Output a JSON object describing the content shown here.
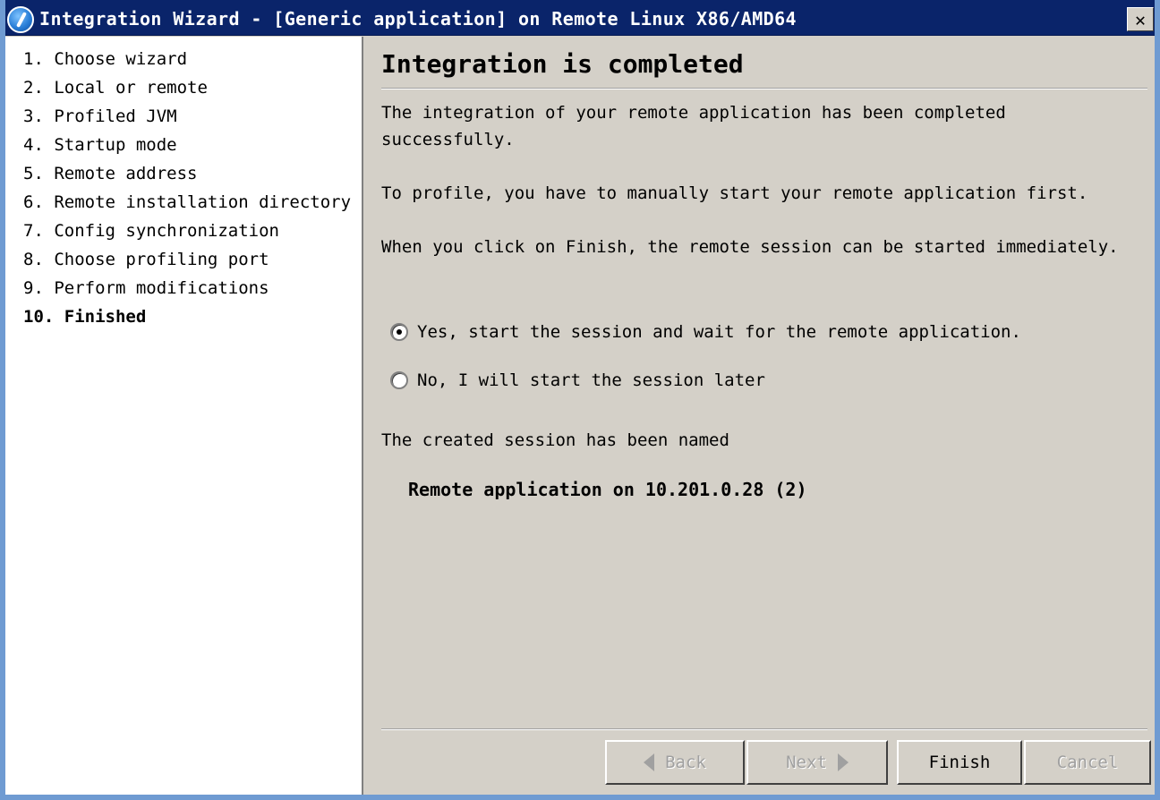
{
  "window": {
    "title": "Integration Wizard - [Generic application] on Remote Linux X86/AMD64",
    "close_label": "✕"
  },
  "steps": [
    {
      "label": "1. Choose wizard"
    },
    {
      "label": "2. Local or remote"
    },
    {
      "label": "3. Profiled JVM"
    },
    {
      "label": "4. Startup mode"
    },
    {
      "label": "5. Remote address"
    },
    {
      "label": "6. Remote installation directory"
    },
    {
      "label": "7. Config synchronization"
    },
    {
      "label": "8. Choose profiling port"
    },
    {
      "label": "9. Perform modifications"
    },
    {
      "label": "10. Finished"
    }
  ],
  "content": {
    "heading": "Integration is completed",
    "para1": "The integration of your remote application has been completed successfully.",
    "para2": "To profile, you have to manually start your remote application first.",
    "para3": "When you click on Finish, the remote session can be started immediately.",
    "radio_yes": "Yes, start the session and wait for the remote application.",
    "radio_no": "No, I will start the session later",
    "named_label": "The created session has been named",
    "session_name": "Remote application on 10.201.0.28 (2)"
  },
  "buttons": {
    "back": "Back",
    "next": "Next",
    "finish": "Finish",
    "cancel": "Cancel"
  }
}
